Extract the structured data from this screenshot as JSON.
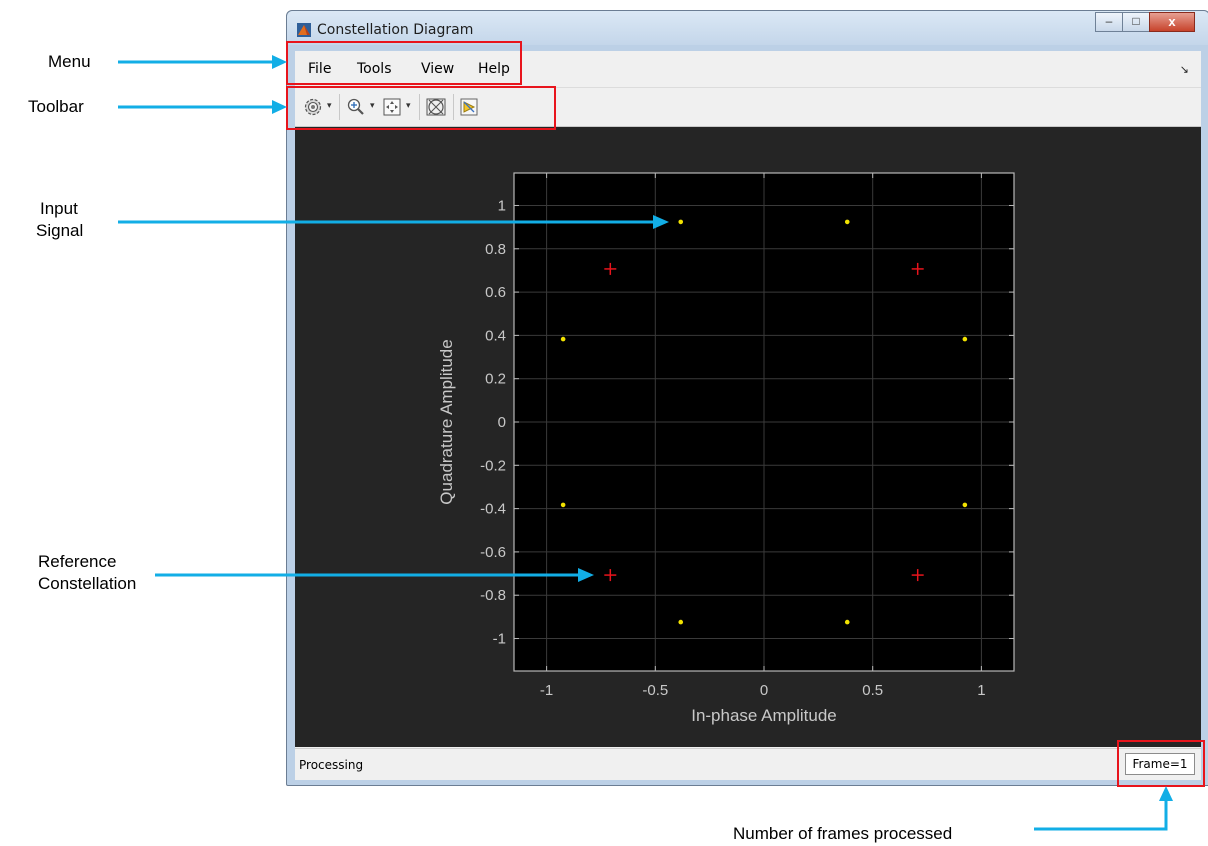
{
  "window": {
    "title": "Constellation Diagram",
    "minimize_glyph": "–",
    "maximize_glyph": "□",
    "close_glyph": "x"
  },
  "menu": {
    "items": [
      "File",
      "Tools",
      "View",
      "Help"
    ]
  },
  "toolbar": {
    "icons": [
      "settings-gear-icon",
      "zoom-in-icon",
      "scale-axes-icon",
      "constellation-reference-icon",
      "highlight-simulink-icon"
    ]
  },
  "chart_data": {
    "type": "scatter",
    "xlabel": "In-phase Amplitude",
    "ylabel": "Quadrature Amplitude",
    "xlim": [
      -1.15,
      1.15
    ],
    "ylim": [
      -1.15,
      1.15
    ],
    "xticks": [
      -1,
      -0.5,
      0,
      0.5,
      1
    ],
    "xtick_labels": [
      "-1",
      "-0.5",
      "0",
      "0.5",
      "1"
    ],
    "yticks": [
      1,
      0.8,
      0.6,
      0.4,
      0.2,
      0,
      -0.2,
      -0.4,
      -0.6,
      -0.8,
      -1
    ],
    "ytick_labels": [
      "1",
      "0.8",
      "0.6",
      "0.4",
      "0.2",
      "0",
      "-0.2",
      "-0.4",
      "-0.6",
      "-0.8",
      "-1"
    ],
    "grid": true,
    "series": [
      {
        "marker": "dot",
        "color": "#f2e200",
        "points": [
          [
            -0.383,
            0.924
          ],
          [
            0.383,
            0.924
          ],
          [
            -0.924,
            0.383
          ],
          [
            0.924,
            0.383
          ],
          [
            -0.924,
            -0.383
          ],
          [
            0.924,
            -0.383
          ],
          [
            -0.383,
            -0.924
          ],
          [
            0.383,
            -0.924
          ]
        ]
      },
      {
        "marker": "plus",
        "color": "#e8141c",
        "points": [
          [
            -0.707,
            0.707
          ],
          [
            0.707,
            0.707
          ],
          [
            -0.707,
            -0.707
          ],
          [
            0.707,
            -0.707
          ]
        ]
      }
    ]
  },
  "status": {
    "text": "Processing",
    "frame": "Frame=1"
  },
  "annotations": {
    "menu": "Menu",
    "toolbar": "Toolbar",
    "input_signal": [
      "Input",
      "Signal"
    ],
    "reference_constellation": [
      "Reference",
      "Constellation"
    ],
    "frames": "Number of frames processed"
  },
  "colors": {
    "arrow": "#12aee6",
    "highlight": "#e8141c",
    "plot_background": "#000000",
    "figure_background": "#252525"
  }
}
